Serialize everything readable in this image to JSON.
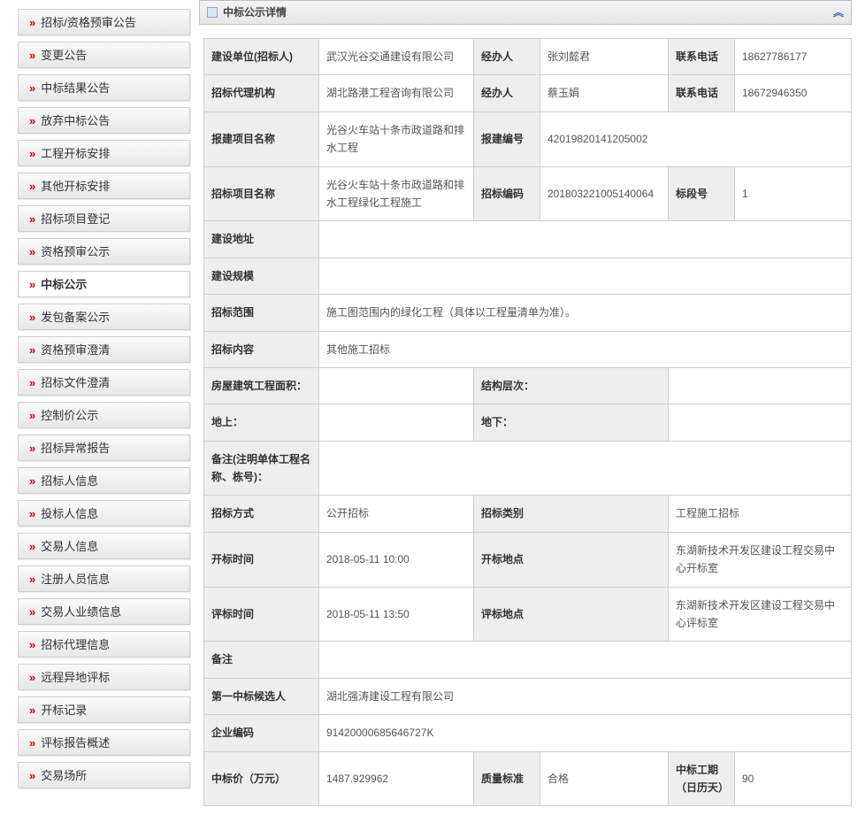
{
  "sidebar": {
    "items": [
      {
        "label": "招标/资格预审公告"
      },
      {
        "label": "变更公告"
      },
      {
        "label": "中标结果公告"
      },
      {
        "label": "放弃中标公告"
      },
      {
        "label": "工程开标安排"
      },
      {
        "label": "其他开标安排"
      },
      {
        "label": "招标项目登记"
      },
      {
        "label": "资格预审公示"
      },
      {
        "label": "中标公示"
      },
      {
        "label": "发包备案公示"
      },
      {
        "label": "资格预审澄清"
      },
      {
        "label": "招标文件澄清"
      },
      {
        "label": "控制价公示"
      },
      {
        "label": "招标异常报告"
      },
      {
        "label": "招标人信息"
      },
      {
        "label": "投标人信息"
      },
      {
        "label": "交易人信息"
      },
      {
        "label": "注册人员信息"
      },
      {
        "label": "交易人业绩信息"
      },
      {
        "label": "招标代理信息"
      },
      {
        "label": "远程异地评标"
      },
      {
        "label": "开标记录"
      },
      {
        "label": "评标报告概述"
      },
      {
        "label": "交易场所"
      }
    ],
    "activeIndex": 8
  },
  "panel": {
    "title": "中标公示详情"
  },
  "d": {
    "owner_lbl": "建设单位(招标人)",
    "owner_val": "武汉光谷交通建设有限公司",
    "owner_contact_lbl": "经办人",
    "owner_contact_val": "张刘懿君",
    "owner_tel_lbl": "联系电话",
    "owner_tel_val": "18627786177",
    "agent_lbl": "招标代理机构",
    "agent_val": "湖北路港工程咨询有限公司",
    "agent_contact_lbl": "经办人",
    "agent_contact_val": "蔡玉娟",
    "agent_tel_lbl": "联系电话",
    "agent_tel_val": "18672946350",
    "proj_lbl": "报建项目名称",
    "proj_val": "光谷火车站十条市政道路和排水工程",
    "proj_no_lbl": "报建编号",
    "proj_no_val": "42019820141205002",
    "bid_proj_lbl": "招标项目名称",
    "bid_proj_val": "光谷火车站十条市政道路和排水工程绿化工程施工",
    "bid_no_lbl": "招标编码",
    "bid_no_val": "20180322100514006​4",
    "section_lbl": "标段号",
    "section_val": "1",
    "addr_lbl": "建设地址",
    "addr_val": "",
    "scale_lbl": "建设规模",
    "scale_val": "",
    "scope_lbl": "招标范围",
    "scope_val": "施工图范围内的绿化工程（具体以工程量清单为准）。",
    "content_lbl": "招标内容",
    "content_val": "其他施工招标",
    "area_lbl": "房屋建筑工程面积：",
    "area_val": "",
    "floors_lbl": "结构层次：",
    "floors_val": "",
    "above_lbl": "地上：",
    "above_val": "",
    "below_lbl": "地下：",
    "below_val": "",
    "remark_lbl": "备注(注明单体工程名称、栋号)：",
    "remark_val": "",
    "method_lbl": "招标方式",
    "method_val": "公开招标",
    "cat_lbl": "招标类别",
    "cat_val": "工程施工招标",
    "open_time_lbl": "开标时间",
    "open_time_val": "2018-05-11 10:00",
    "open_loc_lbl": "开标地点",
    "open_loc_val": "东湖新技术开发区建设工程交易中心开标室",
    "eval_time_lbl": "评标时间",
    "eval_time_val": "2018-05-11 13:50",
    "eval_loc_lbl": "评标地点",
    "eval_loc_val": "东湖新技术开发区建设工程交易中心评标室",
    "note_lbl": "备注",
    "note_val": "",
    "cand1_lbl": "第一中标候选人",
    "cand1_val": "湖北强涛建设工程有限公司",
    "corp_code_lbl": "企业编码",
    "corp_code_val": "91420000685646727K",
    "price_lbl": "中标价（万元）",
    "price_val": "1487.929962",
    "quality_lbl": "质量标准",
    "quality_val": "合格",
    "duration_lbl": "中标工期（日历天）",
    "duration_val": "90"
  }
}
